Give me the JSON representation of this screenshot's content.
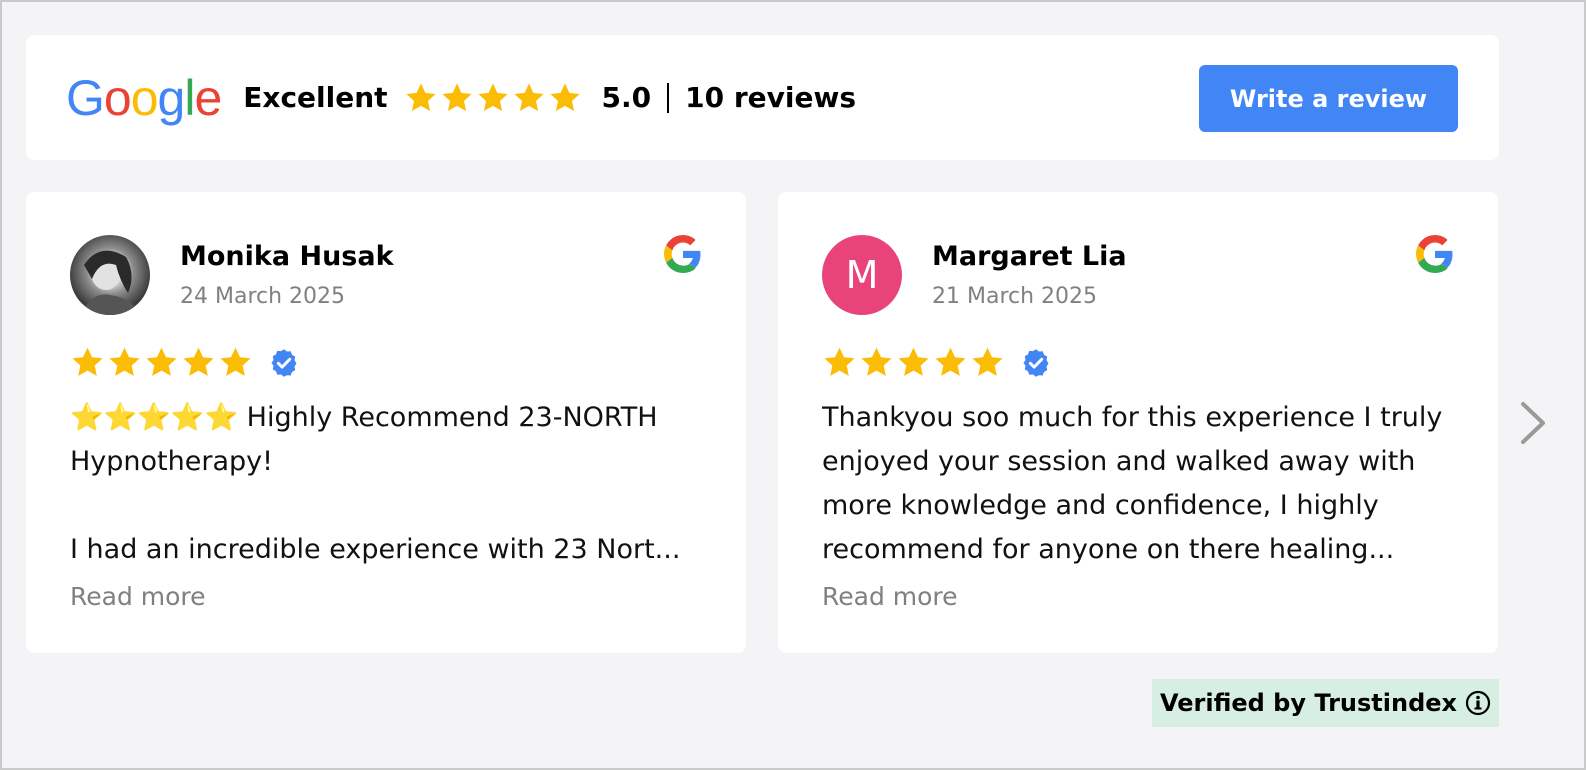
{
  "header": {
    "logo_letters": [
      {
        "ch": "G",
        "color": "#4285F4"
      },
      {
        "ch": "o",
        "color": "#EA4335"
      },
      {
        "ch": "o",
        "color": "#FBBC05"
      },
      {
        "ch": "g",
        "color": "#4285F4"
      },
      {
        "ch": "l",
        "color": "#34A853"
      },
      {
        "ch": "e",
        "color": "#EA4335"
      }
    ],
    "rating_word": "Excellent",
    "score": "5.0",
    "reviews_count": "10 reviews",
    "stars": 5,
    "write_review_label": "Write a review"
  },
  "colors": {
    "star": "#FBBC05",
    "button": "#4285f4",
    "verified": "#4285f4",
    "trust_bg": "#d6efe2"
  },
  "reviews": [
    {
      "name": "Monika Husak",
      "date": "24 March 2025",
      "stars": 5,
      "avatar": "photo",
      "text": "⭐⭐⭐⭐⭐ Highly Recommend 23-NORTH Hypnotherapy!\n\nI had an incredible experience with 23 Nort...",
      "read_more": "Read more"
    },
    {
      "name": "Margaret Lia",
      "date": "21 March 2025",
      "stars": 5,
      "avatar_letter": "M",
      "text": "Thankyou soo much for this experience I truly enjoyed your session and walked away with more knowledge and confidence, I highly recommend for anyone on there healing...",
      "read_more": "Read more"
    }
  ],
  "footer": {
    "verified_label": "Verified by Trustindex"
  },
  "icons": [
    "google-logo",
    "star-icon",
    "google-g-icon",
    "verified-badge-icon",
    "chevron-right-icon",
    "info-icon"
  ]
}
